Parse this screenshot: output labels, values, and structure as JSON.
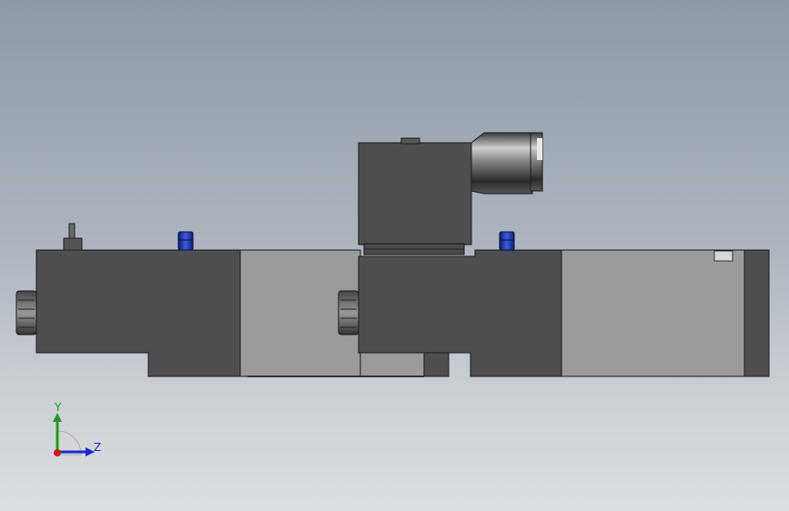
{
  "viewport": {
    "background_top": "#8e9aa8",
    "background_bottom": "#dcdfe2"
  },
  "model": {
    "component": "solenoid-valve-assembly",
    "body_dark": "#4e4e4e",
    "body_light": "#9b9b9b",
    "port_plug_color": "#1c3aa8"
  },
  "triad": {
    "y_label": "Y",
    "z_label": "Z",
    "y_color": "#1f9a1f",
    "z_color": "#1a2ad0",
    "origin_color": "#d01818"
  }
}
